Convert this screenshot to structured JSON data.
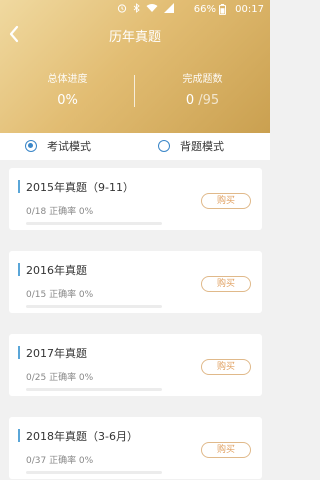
{
  "status_bar": {
    "battery": "66%",
    "time": "00:17"
  },
  "header": {
    "title": "历年真题",
    "overall_progress_label": "总体进度",
    "overall_progress_value": "0%",
    "completed_label": "完成题数",
    "completed_value": "0",
    "completed_total": "/95"
  },
  "modes": [
    {
      "label": "考试模式",
      "selected": true
    },
    {
      "label": "背题模式",
      "selected": false
    }
  ],
  "papers": [
    {
      "title": "2015年真题（9-11）",
      "stats": "0/18 正确率 0%",
      "progress": 0,
      "buy_label": "购买"
    },
    {
      "title": "2016年真题",
      "stats": "0/15 正确率 0%",
      "progress": 0,
      "buy_label": "购买"
    },
    {
      "title": "2017年真题",
      "stats": "0/25 正确率 0%",
      "progress": 0,
      "buy_label": "购买"
    },
    {
      "title": "2018年真题（3-6月）",
      "stats": "0/37 正确率 0%",
      "progress": 0,
      "buy_label": "购买"
    }
  ]
}
